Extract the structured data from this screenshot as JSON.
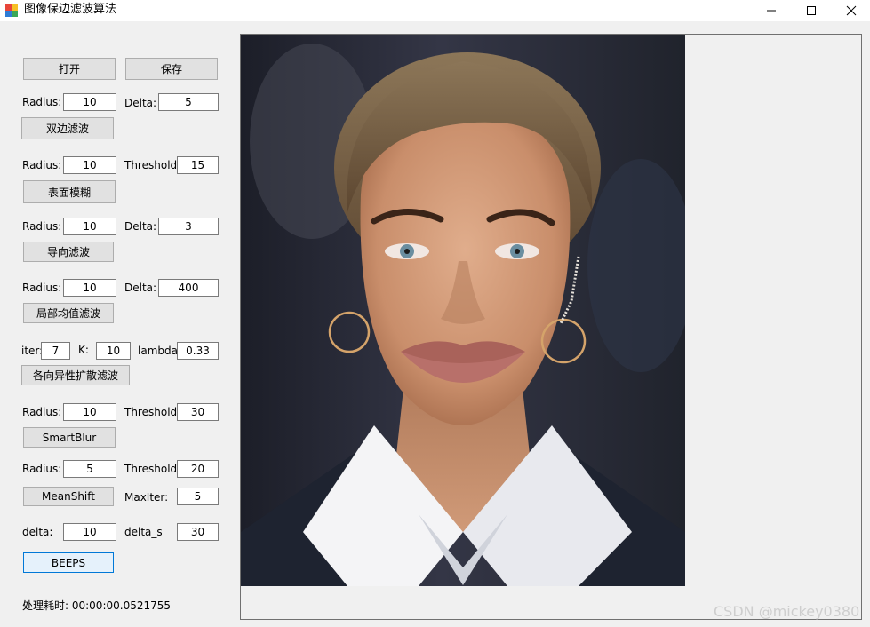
{
  "window": {
    "title": "图像保边滤波算法"
  },
  "file": {
    "open_label": "打开",
    "save_label": "保存"
  },
  "bilateral": {
    "radius_label": "Radius:",
    "radius_value": "10",
    "delta_label": "Delta:",
    "delta_value": "5",
    "button_label": "双边滤波"
  },
  "surface_blur": {
    "radius_label": "Radius:",
    "radius_value": "10",
    "threshold_label": "Threshold:",
    "threshold_value": "15",
    "button_label": "表面模糊"
  },
  "guided": {
    "radius_label": "Radius:",
    "radius_value": "10",
    "delta_label": "Delta:",
    "delta_value": "3",
    "button_label": "导向滤波"
  },
  "local_mean": {
    "radius_label": "Radius:",
    "radius_value": "10",
    "delta_label": "Delta:",
    "delta_value": "400",
    "button_label": "局部均值滤波"
  },
  "anisotropic": {
    "iter_label": "iter:",
    "iter_value": "7",
    "k_label": "K:",
    "k_value": "10",
    "lambda_label": "lambda",
    "lambda_value": "0.33",
    "button_label": "各向异性扩散滤波"
  },
  "smart_blur": {
    "radius_label": "Radius:",
    "radius_value": "10",
    "threshold_label": "Threshold:",
    "threshold_value": "30",
    "button_label": "SmartBlur"
  },
  "mean_shift": {
    "radius_label": "Radius:",
    "radius_value": "5",
    "threshold_label": "Threshold:",
    "threshold_value": "20",
    "button_label": "MeanShift",
    "maxiter_label": "MaxIter:",
    "maxiter_value": "5"
  },
  "beeps": {
    "delta_label": "delta:",
    "delta_value": "10",
    "delta_s_label": "delta_s",
    "delta_s_value": "30",
    "button_label": "BEEPS"
  },
  "status": {
    "elapsed": "处理耗时: 00:00:00.0521755"
  },
  "watermark": "CSDN @mickey0380",
  "colors": {
    "focus_border": "#0078d7",
    "button_face": "#e1e1e1",
    "window_bg": "#f0f0f0"
  }
}
